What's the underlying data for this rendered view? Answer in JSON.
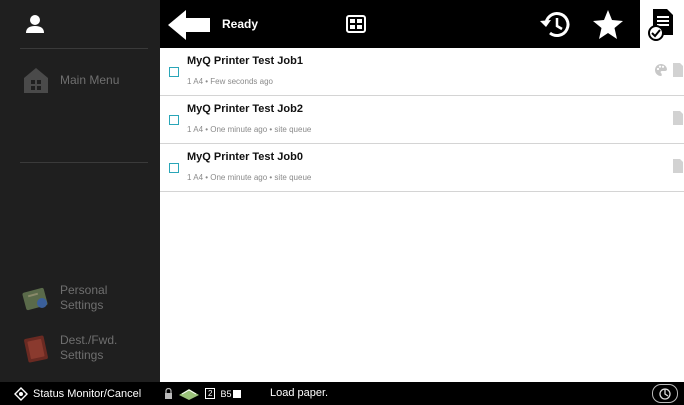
{
  "sidebar": {
    "items": [
      {
        "label": "Main Menu",
        "icon": "home-icon"
      },
      {
        "label": "Personal\nSettings",
        "icon": "personal-settings-icon"
      },
      {
        "label": "Dest./Fwd.\nSettings",
        "icon": "dest-fwd-settings-icon"
      }
    ]
  },
  "topbar": {
    "status": "Ready"
  },
  "jobs": [
    {
      "title": "MyQ Printer Test Job1",
      "meta": "1 A4 • Few seconds ago",
      "color": true
    },
    {
      "title": "MyQ Printer Test Job2",
      "meta": "1 A4 • One minute ago • site queue",
      "color": false
    },
    {
      "title": "MyQ Printer Test Job0",
      "meta": "1 A4 • One minute ago • site queue",
      "color": false
    }
  ],
  "bottombar": {
    "monitor_label": "Status Monitor/Cancel",
    "tray_number": "2",
    "paper_size": "B5",
    "message": "Load paper."
  },
  "colors": {
    "sidebar_bg": "#1f1f1f",
    "checkbox_accent": "#2aa6b8"
  }
}
